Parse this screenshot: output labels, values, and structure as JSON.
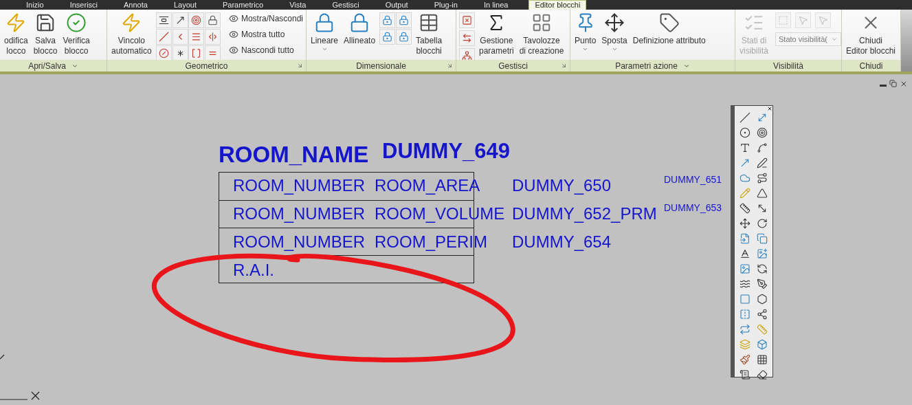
{
  "tabs": [
    {
      "label": "Inizio",
      "selected": false
    },
    {
      "label": "Inserisci",
      "selected": false
    },
    {
      "label": "Annota",
      "selected": false
    },
    {
      "label": "Layout",
      "selected": false
    },
    {
      "label": "Parametrico",
      "selected": false
    },
    {
      "label": "Vista",
      "selected": false
    },
    {
      "label": "Gestisci",
      "selected": false
    },
    {
      "label": "Output",
      "selected": false
    },
    {
      "label": "Plug-in",
      "selected": false
    },
    {
      "label": "In linea",
      "selected": false
    },
    {
      "label": "Editor blocchi",
      "selected": true
    }
  ],
  "panels": [
    {
      "title": "Apri/Salva",
      "menu": true,
      "launcher": false,
      "items": [
        {
          "kind": "large",
          "lines": [
            "odifica",
            "locco"
          ],
          "caret": false,
          "disabled": false
        },
        {
          "kind": "large",
          "lines": [
            "Salva",
            "blocco"
          ],
          "caret": false,
          "disabled": false
        },
        {
          "kind": "large",
          "lines": [
            "Verifica",
            "blocco"
          ],
          "caret": false,
          "disabled": false
        }
      ]
    },
    {
      "title": "Geometrico",
      "menu": false,
      "launcher": true,
      "items": [
        {
          "kind": "large",
          "lines": [
            "Vincolo",
            "automatico"
          ],
          "caret": false,
          "disabled": false
        },
        {
          "kind": "geometric_grid",
          "disabled": false
        },
        {
          "kind": "small_list",
          "labels": [
            "Mostra/Nascondi",
            "Mostra tutto",
            "Nascondi tutto"
          ]
        }
      ]
    },
    {
      "title": "Dimensionale",
      "menu": false,
      "launcher": true,
      "items": [
        {
          "kind": "large",
          "lines": [
            "Lineare"
          ],
          "caret": true,
          "disabled": false
        },
        {
          "kind": "large",
          "lines": [
            "Allineato"
          ],
          "caret": false,
          "disabled": false
        },
        {
          "kind": "dimension_grid",
          "disabled": false
        },
        {
          "kind": "large",
          "lines": [
            "Tabella",
            "blocchi"
          ],
          "caret": false,
          "disabled": false
        }
      ]
    },
    {
      "title": "Gestisci",
      "menu": false,
      "launcher": true,
      "items": [
        {
          "kind": "manage_column",
          "disabled": false
        },
        {
          "kind": "large",
          "lines": [
            "Gestione",
            "parametri"
          ],
          "caret": false,
          "disabled": false
        },
        {
          "kind": "large",
          "lines": [
            "Tavolozze",
            "di creazione"
          ],
          "caret": false,
          "disabled": false
        }
      ]
    },
    {
      "title": "Parametri azione",
      "menu": true,
      "launcher": false,
      "items": [
        {
          "kind": "large",
          "lines": [
            "Punto"
          ],
          "caret": true,
          "disabled": false
        },
        {
          "kind": "large",
          "lines": [
            "Sposta"
          ],
          "caret": true,
          "disabled": false
        },
        {
          "kind": "large",
          "lines": [
            "Definizione attributo"
          ],
          "caret": false,
          "disabled": false
        }
      ]
    },
    {
      "title": "Visibilità",
      "menu": false,
      "launcher": false,
      "items": [
        {
          "kind": "large",
          "lines": [
            "Stati di",
            "visibilità"
          ],
          "caret": false,
          "disabled": true
        },
        {
          "kind": "visibility_tools",
          "dropdown": "Stato visibilità(",
          "disabled": true
        }
      ]
    },
    {
      "title": "Chiudi",
      "menu": false,
      "launcher": false,
      "items": [
        {
          "kind": "large",
          "lines": [
            "Chiudi",
            "Editor blocchi"
          ],
          "caret": false,
          "disabled": false
        }
      ]
    }
  ],
  "drawing": {
    "title_texts": [
      "ROOM_NAME",
      "DUMMY_649"
    ],
    "rows": [
      {
        "texts": [
          "ROOM_NUMBER",
          "ROOM_AREA",
          "DUMMY_650"
        ],
        "small": "DUMMY_651"
      },
      {
        "texts": [
          "ROOM_NUMBER",
          "ROOM_VOLUME",
          "DUMMY_652_PRM"
        ],
        "small": "DUMMY_653"
      },
      {
        "texts": [
          "ROOM_NUMBER",
          "ROOM_PERIM",
          "DUMMY_654"
        ],
        "small": ""
      },
      {
        "texts": [
          "R.A.I."
        ],
        "small": ""
      }
    ]
  }
}
